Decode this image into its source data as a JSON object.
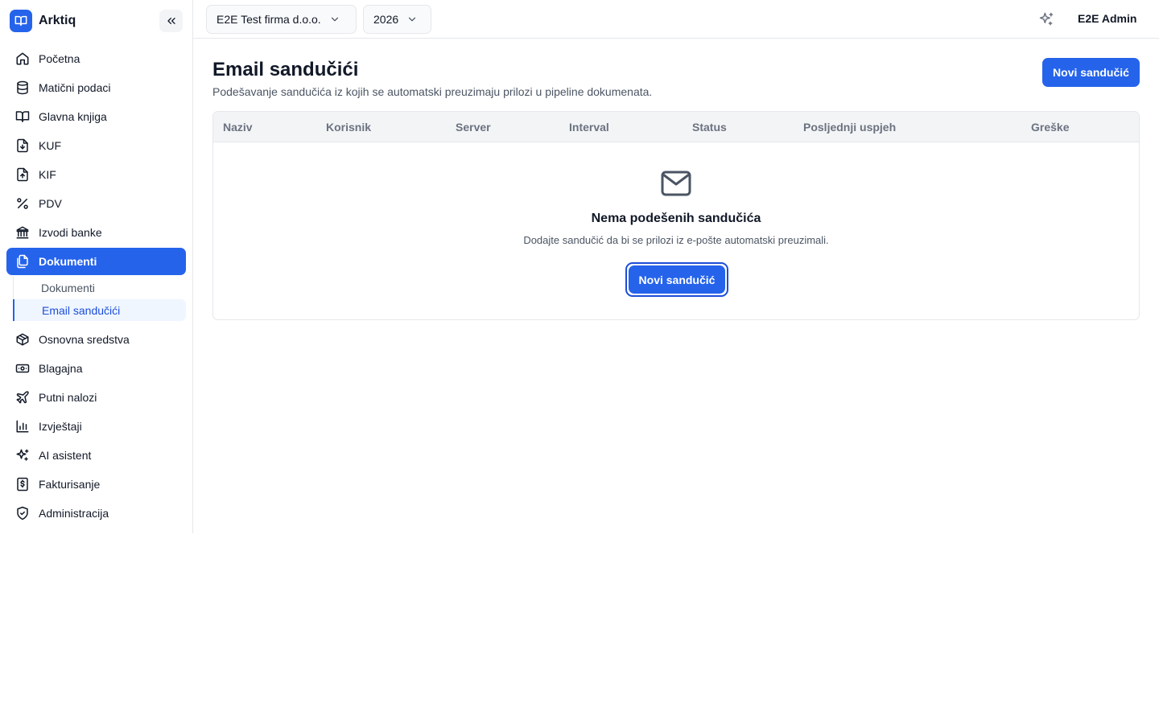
{
  "brand": {
    "name": "Arktiq",
    "accent": "#2563eb"
  },
  "sidebar": {
    "items": [
      {
        "label": "Početna",
        "icon": "home-icon"
      },
      {
        "label": "Matični podaci",
        "icon": "database-icon"
      },
      {
        "label": "Glavna knjiga",
        "icon": "book-icon"
      },
      {
        "label": "KUF",
        "icon": "file-download-icon"
      },
      {
        "label": "KIF",
        "icon": "file-upload-icon"
      },
      {
        "label": "PDV",
        "icon": "percent-icon"
      },
      {
        "label": "Izvodi banke",
        "icon": "bank-icon"
      },
      {
        "label": "Dokumenti",
        "icon": "documents-icon",
        "active": true
      },
      {
        "label": "Osnovna sredstva",
        "icon": "package-icon"
      },
      {
        "label": "Blagajna",
        "icon": "cash-icon"
      },
      {
        "label": "Putni nalozi",
        "icon": "plane-icon"
      },
      {
        "label": "Izvještaji",
        "icon": "bar-chart-icon"
      },
      {
        "label": "AI asistent",
        "icon": "sparkles-icon"
      },
      {
        "label": "Fakturisanje",
        "icon": "dollar-file-icon"
      },
      {
        "label": "Administracija",
        "icon": "shield-check-icon"
      }
    ],
    "sub_items": [
      {
        "label": "Dokumenti"
      },
      {
        "label": "Email sandučići",
        "active": true
      }
    ]
  },
  "topbar": {
    "company": "E2E Test firma d.o.o.",
    "year": "2026",
    "user": "E2E Admin"
  },
  "main": {
    "title": "Email sandučići",
    "subtitle": "Podešavanje sandučića iz kojih se automatski preuzimaju prilozi u pipeline dokumenata.",
    "new_button": "Novi sandučić",
    "table": {
      "columns": [
        "Naziv",
        "Korisnik",
        "Server",
        "Interval",
        "Status",
        "Posljednji uspjeh",
        "Greške"
      ]
    },
    "empty": {
      "title": "Nema podešenih sandučića",
      "description": "Dodajte sandučić da bi se prilozi iz e-pošte automatski preuzimali.",
      "button": "Novi sandučić"
    }
  }
}
